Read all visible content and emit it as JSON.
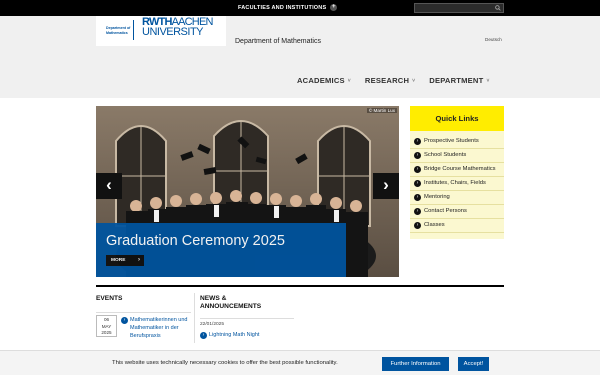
{
  "topbar": {
    "faculties_label": "FACULTIES AND INSTITUTIONS",
    "plus_glyph": "+",
    "search_placeholder": "",
    "search_icon": "search-icon"
  },
  "header": {
    "logo_dept": "Department of Mathematics",
    "logo_rwth": "RWTH",
    "logo_aachen": "AACHEN",
    "logo_university": "UNIVERSITY",
    "dept_title": "Department of Mathematics",
    "language": "Deutsch"
  },
  "nav": {
    "items": [
      {
        "label": "ACADEMICS"
      },
      {
        "label": "RESEARCH"
      },
      {
        "label": "DEPARTMENT"
      }
    ],
    "chevron": "˅"
  },
  "hero": {
    "credit": "© Martin Lux",
    "title": "Graduation Ceremony 2025",
    "more_label": "MORE",
    "more_chevron": "›",
    "prev_glyph": "‹",
    "next_glyph": "›"
  },
  "quick_links": {
    "title": "Quick Links",
    "bullet": "›",
    "items": [
      {
        "label": "Prospective Students"
      },
      {
        "label": "School Students"
      },
      {
        "label": "Bridge Course Mathematics"
      },
      {
        "label": "Institutes, Chairs, Fields"
      },
      {
        "label": "Mentoring"
      },
      {
        "label": "Contact Persons"
      },
      {
        "label": "Classes"
      }
    ]
  },
  "events": {
    "title": "EVENTS",
    "items": [
      {
        "day": "06",
        "month": "MAY",
        "year": "2025",
        "text": "Mathematikerinnen und Mathematiker in der Berufspraxis"
      }
    ]
  },
  "news": {
    "title": "NEWS & ANNOUNCEMENTS",
    "items": [
      {
        "date": "22/01/2025",
        "text": "Lightning Math Night"
      }
    ]
  },
  "cookie": {
    "text": "This website uses technically necessary cookies to offer the best possible functionality.",
    "info_label": "Further Information",
    "accept_label": "Accept!"
  },
  "colors": {
    "brand_blue": "#00549f",
    "accent_yellow": "#ffed00",
    "topbar": "#000000"
  }
}
